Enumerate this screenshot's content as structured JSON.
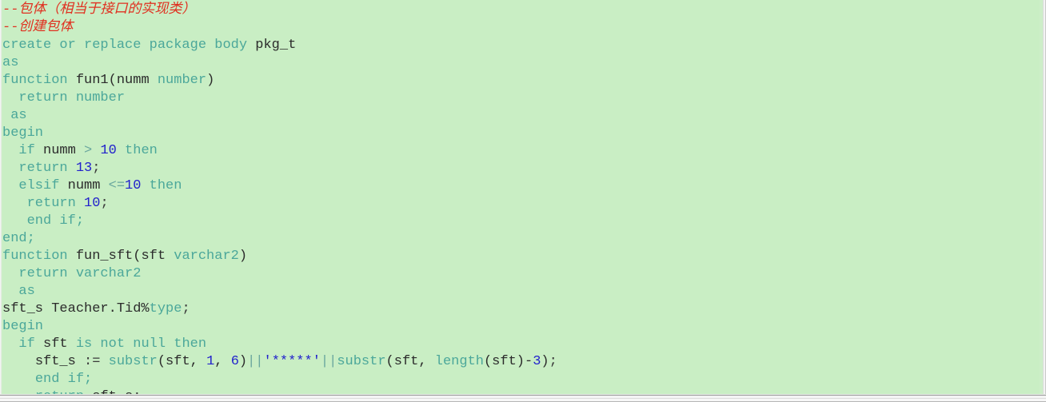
{
  "editor": {
    "name": "sql-code-editor",
    "background_color": "#c9eec4",
    "language": "PL/SQL",
    "colors": {
      "comment": "#e03020",
      "keyword": "#4ba79a",
      "identifier": "#2b2b2b",
      "number": "#2222cc",
      "string": "#2222cc",
      "operator": "#6aa79e"
    }
  },
  "code": {
    "lines": [
      {
        "id": "line-1",
        "indent": 0,
        "tokens": [
          {
            "t": "--包体（相当于接口的实现类）",
            "c": "cmt"
          }
        ]
      },
      {
        "id": "line-2",
        "indent": 0,
        "tokens": [
          {
            "t": "--创建包体",
            "c": "cmt"
          }
        ]
      },
      {
        "id": "line-3",
        "indent": 0,
        "tokens": [
          {
            "t": "create or replace package body ",
            "c": "kw"
          },
          {
            "t": "pkg_t",
            "c": "id"
          }
        ]
      },
      {
        "id": "line-4",
        "indent": 0,
        "tokens": [
          {
            "t": "as",
            "c": "kw"
          }
        ]
      },
      {
        "id": "line-5",
        "indent": 0,
        "tokens": [
          {
            "t": "function ",
            "c": "kw"
          },
          {
            "t": "fun1(numm ",
            "c": "id"
          },
          {
            "t": "number",
            "c": "kw"
          },
          {
            "t": ")",
            "c": "id"
          }
        ]
      },
      {
        "id": "line-6",
        "indent": 2,
        "tokens": [
          {
            "t": "return number",
            "c": "kw"
          }
        ]
      },
      {
        "id": "line-7",
        "indent": 1,
        "tokens": [
          {
            "t": "as",
            "c": "kw"
          }
        ]
      },
      {
        "id": "line-8",
        "indent": 0,
        "tokens": [
          {
            "t": "begin",
            "c": "kw"
          }
        ]
      },
      {
        "id": "line-9",
        "indent": 2,
        "tokens": [
          {
            "t": "if ",
            "c": "kw"
          },
          {
            "t": "numm ",
            "c": "id"
          },
          {
            "t": "> ",
            "c": "op"
          },
          {
            "t": "10",
            "c": "num"
          },
          {
            "t": " then",
            "c": "kw"
          }
        ]
      },
      {
        "id": "line-10",
        "indent": 2,
        "tokens": [
          {
            "t": "return ",
            "c": "kw"
          },
          {
            "t": "13",
            "c": "num"
          },
          {
            "t": ";",
            "c": "punct"
          }
        ]
      },
      {
        "id": "line-11",
        "indent": 2,
        "tokens": [
          {
            "t": "elsif ",
            "c": "kw"
          },
          {
            "t": "numm ",
            "c": "id"
          },
          {
            "t": "<=",
            "c": "op"
          },
          {
            "t": "10",
            "c": "num"
          },
          {
            "t": " then",
            "c": "kw"
          }
        ]
      },
      {
        "id": "line-12",
        "indent": 3,
        "tokens": [
          {
            "t": "return ",
            "c": "kw"
          },
          {
            "t": "10",
            "c": "num"
          },
          {
            "t": ";",
            "c": "punct"
          }
        ]
      },
      {
        "id": "line-13",
        "indent": 3,
        "tokens": [
          {
            "t": "end if;",
            "c": "kw"
          }
        ]
      },
      {
        "id": "line-14",
        "indent": 0,
        "tokens": [
          {
            "t": "end;",
            "c": "kw"
          }
        ]
      },
      {
        "id": "line-15",
        "indent": 0,
        "tokens": [
          {
            "t": "function ",
            "c": "kw"
          },
          {
            "t": "fun_sft(sft ",
            "c": "id"
          },
          {
            "t": "varchar2",
            "c": "kw"
          },
          {
            "t": ")",
            "c": "id"
          }
        ]
      },
      {
        "id": "line-16",
        "indent": 2,
        "tokens": [
          {
            "t": "return varchar2",
            "c": "kw"
          }
        ]
      },
      {
        "id": "line-17",
        "indent": 2,
        "tokens": [
          {
            "t": "as",
            "c": "kw"
          }
        ]
      },
      {
        "id": "line-18",
        "indent": 0,
        "tokens": [
          {
            "t": "sft_s Teacher.Tid%",
            "c": "id"
          },
          {
            "t": "type",
            "c": "kw"
          },
          {
            "t": ";",
            "c": "punct"
          }
        ]
      },
      {
        "id": "line-19",
        "indent": 0,
        "tokens": [
          {
            "t": "begin",
            "c": "kw"
          }
        ]
      },
      {
        "id": "line-20",
        "indent": 2,
        "tokens": [
          {
            "t": "if ",
            "c": "kw"
          },
          {
            "t": "sft ",
            "c": "id"
          },
          {
            "t": "is not null then",
            "c": "kw"
          }
        ]
      },
      {
        "id": "line-21",
        "indent": 4,
        "tokens": [
          {
            "t": "sft_s ",
            "c": "id"
          },
          {
            "t": ":= ",
            "c": "punct"
          },
          {
            "t": "substr",
            "c": "kw"
          },
          {
            "t": "(sft, ",
            "c": "id"
          },
          {
            "t": "1",
            "c": "num"
          },
          {
            "t": ", ",
            "c": "id"
          },
          {
            "t": "6",
            "c": "num"
          },
          {
            "t": ")",
            "c": "id"
          },
          {
            "t": "||",
            "c": "op"
          },
          {
            "t": "'*****'",
            "c": "str"
          },
          {
            "t": "||",
            "c": "op"
          },
          {
            "t": "substr",
            "c": "kw"
          },
          {
            "t": "(sft, ",
            "c": "id"
          },
          {
            "t": "length",
            "c": "kw"
          },
          {
            "t": "(sft)-",
            "c": "id"
          },
          {
            "t": "3",
            "c": "num"
          },
          {
            "t": ")",
            "c": "id"
          },
          {
            "t": ";",
            "c": "punct"
          }
        ]
      },
      {
        "id": "line-22",
        "indent": 4,
        "tokens": [
          {
            "t": "end if;",
            "c": "kw"
          }
        ]
      },
      {
        "id": "line-23",
        "indent": 4,
        "clipped": true,
        "tokens": [
          {
            "t": "return ",
            "c": "kw"
          },
          {
            "t": "sft_s",
            "c": "id"
          },
          {
            "t": ";",
            "c": "punct"
          }
        ]
      }
    ]
  }
}
